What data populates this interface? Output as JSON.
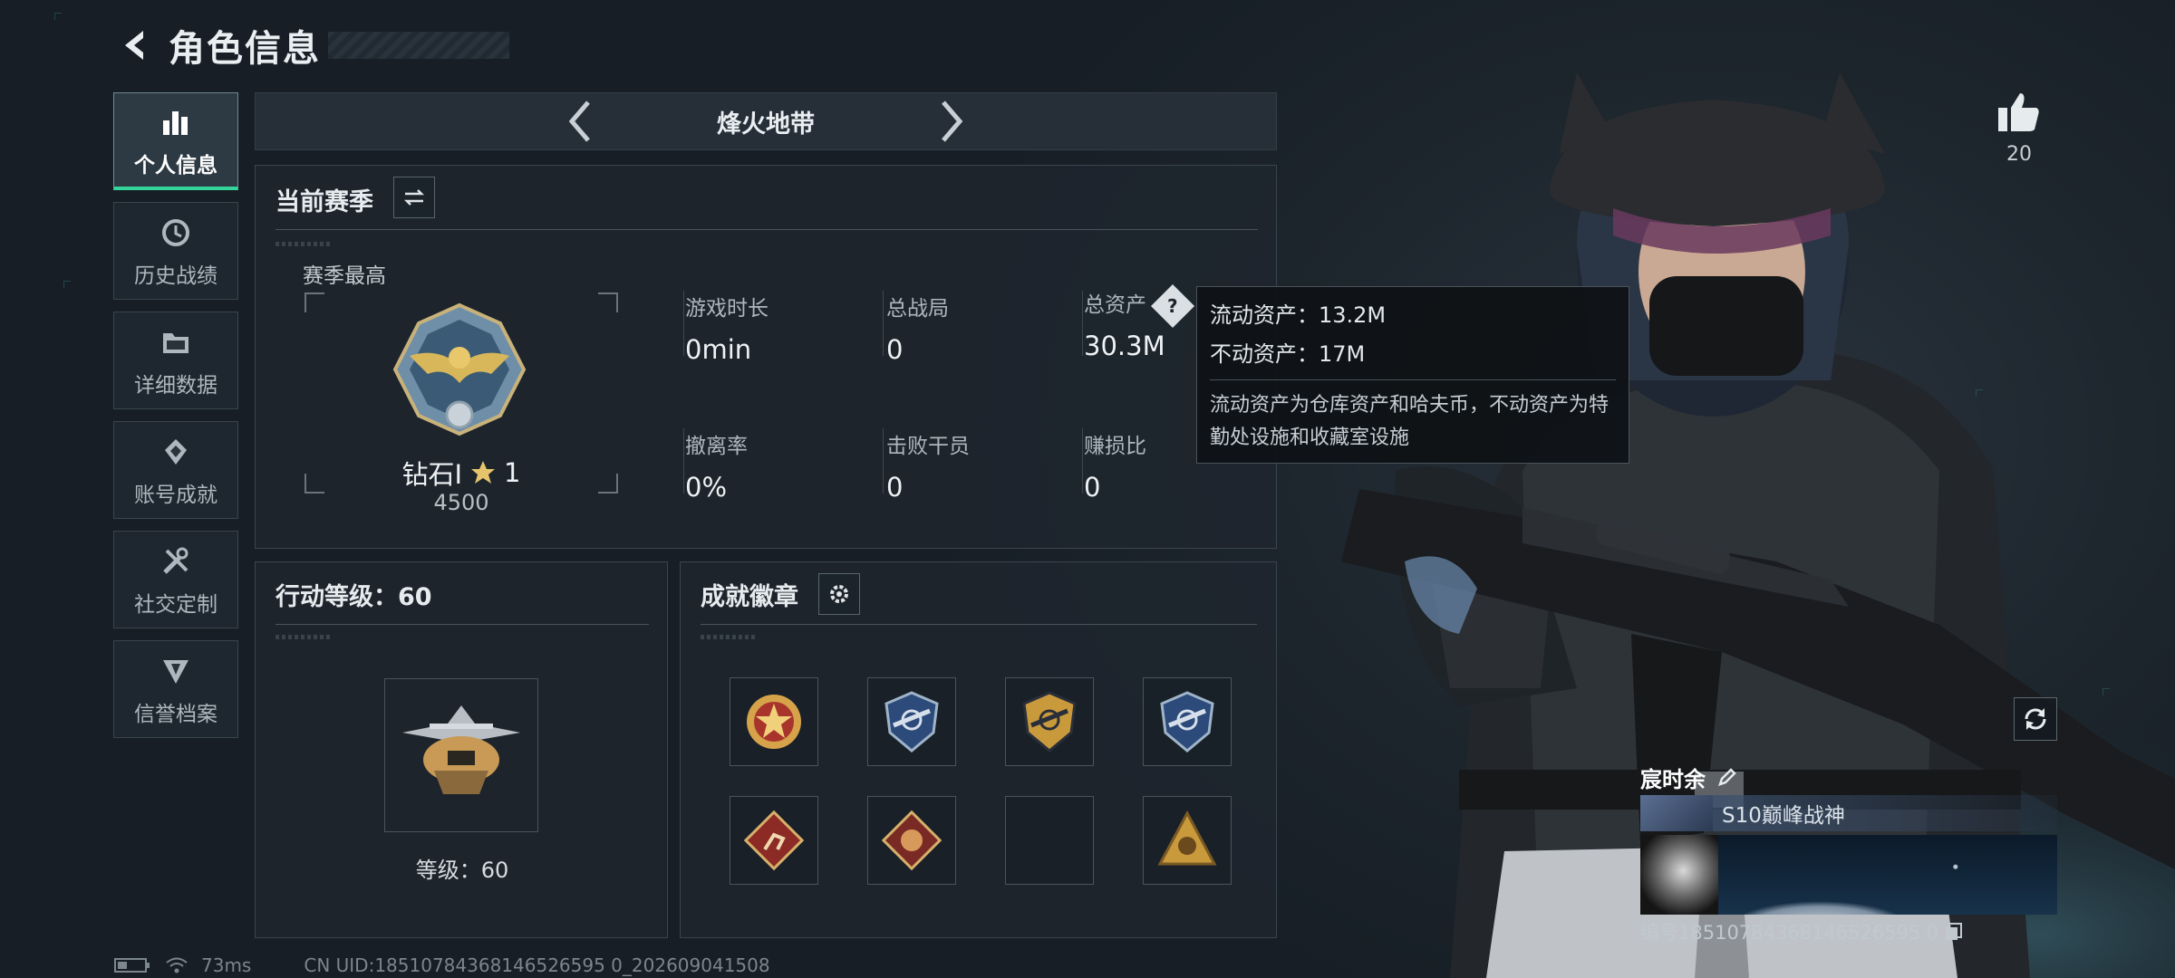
{
  "header": {
    "title": "角色信息"
  },
  "sidebar": {
    "items": [
      {
        "label": "个人信息",
        "icon": "bar-chart-icon",
        "active": true
      },
      {
        "label": "历史战绩",
        "icon": "history-icon"
      },
      {
        "label": "详细数据",
        "icon": "folder-icon"
      },
      {
        "label": "账号成就",
        "icon": "achievement-icon"
      },
      {
        "label": "社交定制",
        "icon": "tools-icon"
      },
      {
        "label": "信誉档案",
        "icon": "shield-icon"
      }
    ]
  },
  "mode": {
    "title": "烽火地带"
  },
  "season": {
    "title": "当前赛季",
    "best_label": "赛季最高",
    "rank_name": "钻石Ⅰ",
    "rank_stars": "1",
    "rank_score": "4500",
    "stats": [
      {
        "label": "游戏时长",
        "value": "0min"
      },
      {
        "label": "总战局",
        "value": "0"
      },
      {
        "label": "总资产",
        "value": "30.3M"
      },
      {
        "label": "撤离率",
        "value": "0%"
      },
      {
        "label": "击败干员",
        "value": "0"
      },
      {
        "label": "赚损比",
        "value": "0"
      }
    ]
  },
  "tooltip": {
    "line1": "流动资产：13.2M",
    "line2": "不动资产：17M",
    "desc": "流动资产为仓库资产和哈夫币，不动资产为特勤处设施和收藏室设施"
  },
  "level": {
    "title": "行动等级：60",
    "label": "等级：60"
  },
  "badges": {
    "title": "成就徽章"
  },
  "likes": {
    "count": "20"
  },
  "player": {
    "name": "宸时余",
    "title": "S10巅峰战神",
    "uid": "编号18510784368146526595 0"
  },
  "status": {
    "ping": "73ms",
    "uid": "CN UID:18510784368146526595 0_202609041508"
  },
  "colors": {
    "accent": "#34d49a",
    "panel": "#1e262e",
    "tooltip": "#0e1114"
  }
}
